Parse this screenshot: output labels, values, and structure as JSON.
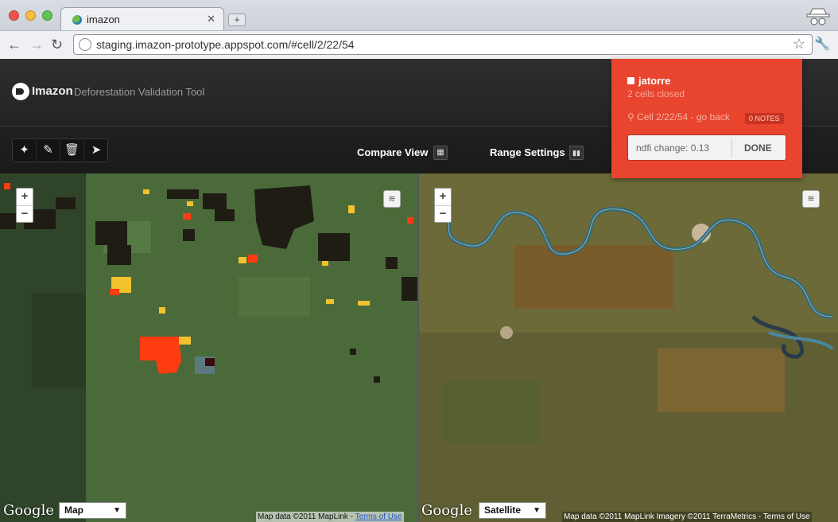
{
  "browser": {
    "tab_title": "imazon",
    "url": "staging.imazon-prototype.appspot.com/#cell/2/22/54"
  },
  "header": {
    "logo": "Imazon",
    "subtitle": "Deforestation Validation Tool"
  },
  "tools": {
    "compare_label": "Compare View",
    "range_label": "Range Settings"
  },
  "user_panel": {
    "username": "jatorre",
    "cells_closed": "2 cells closed",
    "cell_link": "Cell 2/22/54 - go back",
    "notes_badge": "0 NOTES",
    "ndfi_change": "ndfi change: 0.13",
    "done_label": "DONE",
    "background": "#e9442e"
  },
  "map_left": {
    "maptype": "Map",
    "google": "Google",
    "attribution": "Map data ©2011 MapLink - ",
    "terms": "Terms of Use"
  },
  "map_right": {
    "maptype": "Satellite",
    "google": "Google",
    "attribution": "Map data ©2011 MapLink Imagery ©2011 TerraMetrics - Terms of Use"
  }
}
